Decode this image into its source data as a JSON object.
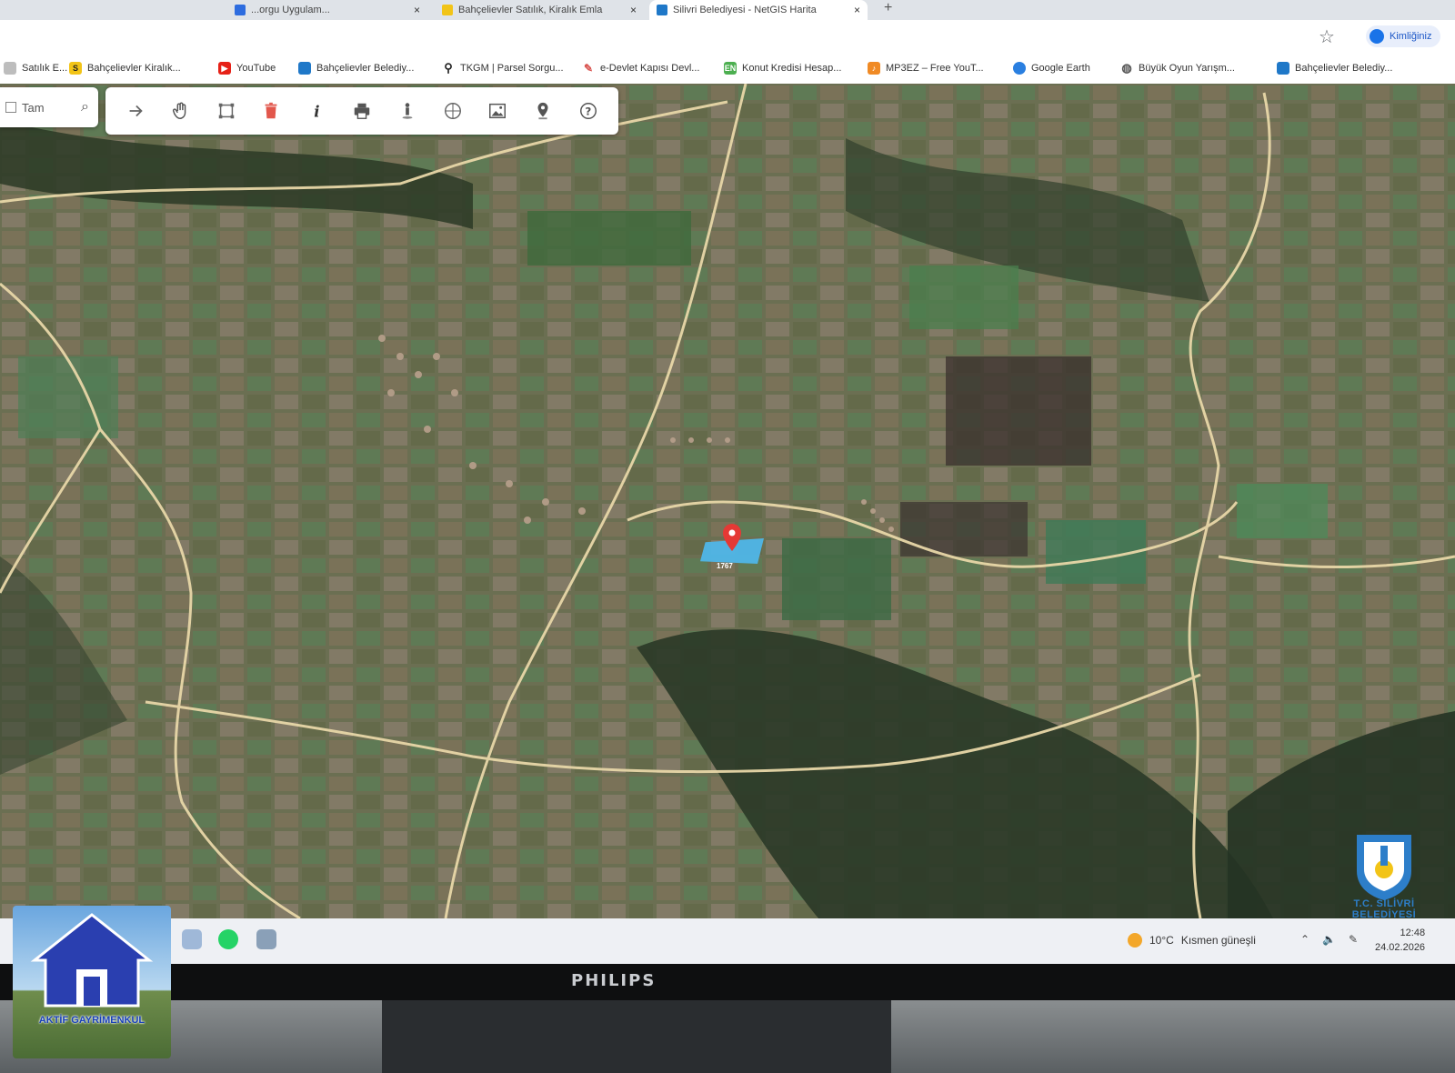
{
  "browser": {
    "tabs": [
      {
        "label": "...orgu Uygulam...",
        "active": false,
        "favicon_color": "#2d6cdf"
      },
      {
        "label": "Bahçelievler Satılık, Kiralık Emla",
        "active": false,
        "favicon_color": "#f2c417"
      },
      {
        "label": "Silivri Belediyesi - NetGIS Harita",
        "active": true,
        "favicon_color": "#1f78c8"
      }
    ],
    "new_tab_label": "+",
    "close_label": "×",
    "profile_label": "Kimliğiniz",
    "bookmarks": [
      {
        "label": "Satılık E...",
        "icon": "page-icon",
        "color": "#bdbdbd"
      },
      {
        "label": "Bahçelievler Kiralık...",
        "icon": "sahibinden-icon",
        "color": "#f2c417"
      },
      {
        "label": "YouTube",
        "icon": "youtube-icon",
        "color": "#e62117"
      },
      {
        "label": "Bahçelievler Belediy...",
        "icon": "municipality-icon",
        "color": "#1f78c8"
      },
      {
        "label": "TKGM | Parsel Sorgu...",
        "icon": "location-pin-icon",
        "color": "#222222"
      },
      {
        "label": "e-Devlet Kapısı Devl...",
        "icon": "edevlet-icon",
        "color": "#d9534f"
      },
      {
        "label": "Konut Kredisi Hesap...",
        "icon": "en-icon",
        "color": "#4caf50"
      },
      {
        "label": "MP3EZ – Free YouT...",
        "icon": "mp3-icon",
        "color": "#f08a24"
      },
      {
        "label": "Google Earth",
        "icon": "google-earth-icon",
        "color": "#2a7fe0"
      },
      {
        "label": "Büyük Oyun Yarışm...",
        "icon": "globe-icon",
        "color": "#555555"
      },
      {
        "label": "Bahçelievler Belediy...",
        "icon": "municipality-icon",
        "color": "#1f78c8"
      }
    ]
  },
  "map": {
    "search": {
      "checkbox_label": "Tam",
      "icon": "search-icon"
    },
    "toolbar": [
      {
        "name": "forward-arrow-icon"
      },
      {
        "name": "pan-hand-icon"
      },
      {
        "name": "select-area-icon"
      },
      {
        "name": "delete-icon"
      },
      {
        "name": "info-icon"
      },
      {
        "name": "print-icon"
      },
      {
        "name": "street-view-icon"
      },
      {
        "name": "layers-icon"
      },
      {
        "name": "image-export-icon"
      },
      {
        "name": "marker-icon"
      },
      {
        "name": "help-icon"
      }
    ],
    "parcel_label": "1767",
    "marker_color": "#e53935",
    "parcel_color": "#4fb6e8",
    "road_color": "#e8d7a8",
    "logo_caption": "T.C. SİLİVRİ BELEDİYESİ"
  },
  "taskbar": {
    "weather_temp": "10°C",
    "weather_text": "Kısmen güneşli",
    "time": "12:48",
    "date": "24.02.2026"
  },
  "monitor": {
    "brand": "PHILIPS"
  },
  "watermark": {
    "agency_name": "AKTİF GAYRİMENKUL"
  }
}
